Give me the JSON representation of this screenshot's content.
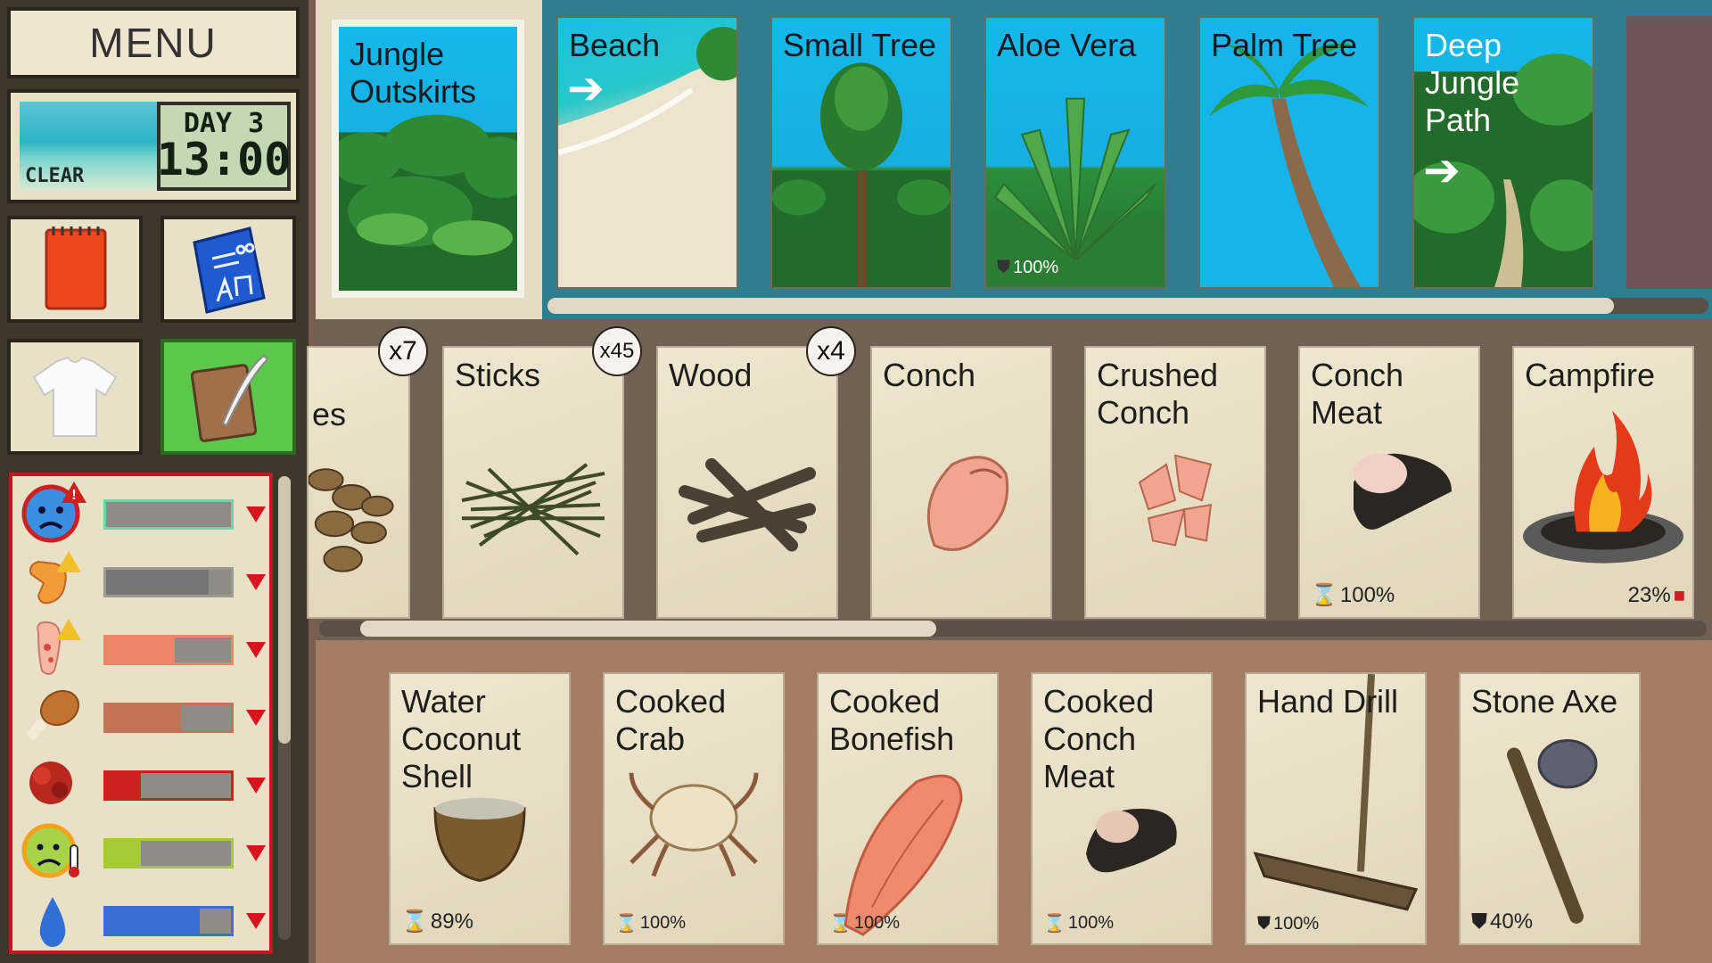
{
  "sidebar": {
    "menu_label": "MENU",
    "weather": "CLEAR",
    "day": "DAY 3",
    "time": "13:00",
    "tiles": [
      {
        "name": "journal-tile",
        "icon": "red-notebook-icon"
      },
      {
        "name": "blueprint-tile",
        "icon": "blueprint-icon"
      },
      {
        "name": "clothing-tile",
        "icon": "tshirt-icon"
      },
      {
        "name": "crafting-journal-tile",
        "icon": "quill-notebook-icon",
        "active": true
      }
    ],
    "stats": [
      {
        "icon": "morale-face-icon",
        "fill": 0.0,
        "color": "#6fd3a8",
        "alert": true
      },
      {
        "icon": "pain-icon",
        "fill": 0.82,
        "color": "#767676",
        "alert": true
      },
      {
        "icon": "foot-injury-icon",
        "fill": 0.55,
        "color": "#ef846a",
        "alert": true
      },
      {
        "icon": "hunger-drumstick-icon",
        "fill": 0.6,
        "color": "#c47255",
        "alert": false
      },
      {
        "icon": "blood-icon",
        "fill": 0.28,
        "color": "#d01f1f",
        "alert": false
      },
      {
        "icon": "fever-face-icon",
        "fill": 0.28,
        "color": "#a6c93a",
        "alert": false
      },
      {
        "icon": "water-drop-icon",
        "fill": 0.75,
        "color": "#3c6fd6",
        "alert": false
      }
    ]
  },
  "locations": {
    "current": {
      "title": "Jungle Outskirts"
    },
    "cards": [
      {
        "title": "Beach",
        "kind": "exit",
        "icon": "arrow-right-icon"
      },
      {
        "title": "Small Tree",
        "kind": "plant"
      },
      {
        "title": "Aloe Vera",
        "kind": "plant",
        "percent": "100%",
        "percent_icon": "durability-shield-icon"
      },
      {
        "title": "Palm Tree",
        "kind": "plant"
      },
      {
        "title": "Deep Jungle Path",
        "kind": "exit",
        "icon": "arrow-right-icon"
      }
    ],
    "scroll_fraction": 0.92
  },
  "items": {
    "cards": [
      {
        "title": "es",
        "count": "x7"
      },
      {
        "title": "Sticks",
        "count": "x45"
      },
      {
        "title": "Wood",
        "count": "x4"
      },
      {
        "title": "Conch"
      },
      {
        "title": "Crushed Conch"
      },
      {
        "title": "Conch Meat",
        "percent": "100%",
        "percent_icon": "hourglass-icon"
      },
      {
        "title": "Campfire",
        "percent": "23%",
        "percent_icon": "fuel-can-icon"
      }
    ],
    "scroll_fraction": 0.36
  },
  "inventory": {
    "cards": [
      {
        "title": "Water Coconut Shell",
        "percent": "89%",
        "percent_icon": "hourglass-icon"
      },
      {
        "title": "Cooked Crab",
        "percent": "100%",
        "percent_icon": "hourglass-icon"
      },
      {
        "title": "Cooked Bonefish",
        "percent": "100%",
        "percent_icon": "hourglass-icon"
      },
      {
        "title": "Cooked Conch Meat",
        "percent": "100%",
        "percent_icon": "hourglass-icon"
      },
      {
        "title": "Hand Drill",
        "percent": "100%",
        "percent_icon": "durability-shield-icon"
      },
      {
        "title": "Stone Axe",
        "percent": "40%",
        "percent_icon": "durability-shield-icon"
      }
    ]
  }
}
